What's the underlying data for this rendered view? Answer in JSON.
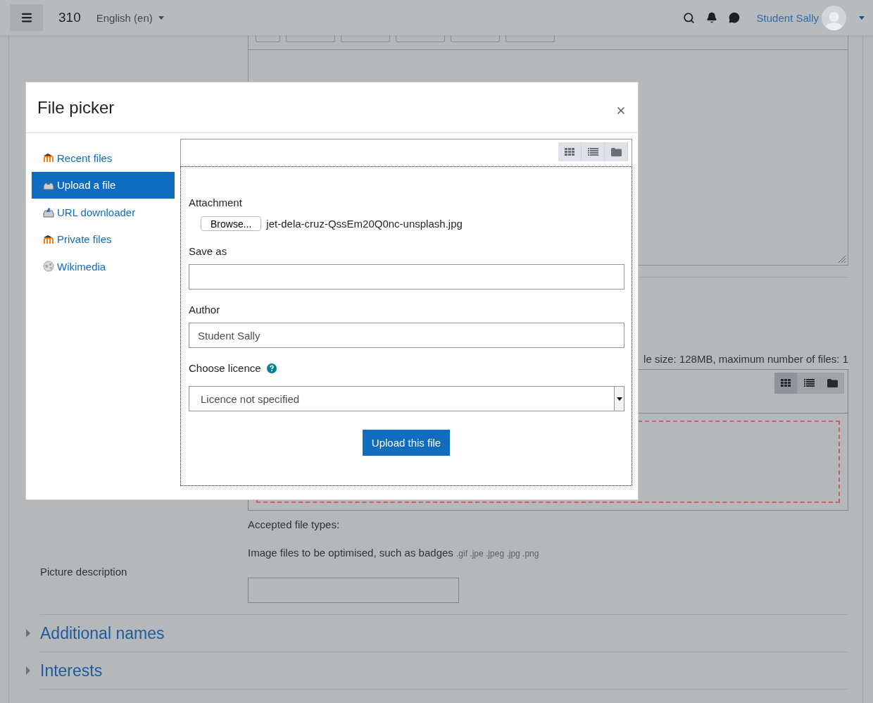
{
  "header": {
    "site_name": "310",
    "language": "English (en)",
    "user_name": "Student Sally"
  },
  "filemanager": {
    "limits_text": "le size: 128MB, maximum number of files: 1",
    "views": [
      {
        "kind": "icons",
        "selected": true
      },
      {
        "kind": "list",
        "selected": false
      },
      {
        "kind": "tree",
        "selected": false
      }
    ]
  },
  "accepted": {
    "label": "Accepted file types:",
    "description": "Image files to be optimised, such as badges",
    "extensions": ".gif .jpe .jpeg .jpg .png"
  },
  "picture_description": {
    "label": "Picture description"
  },
  "sections": [
    {
      "title": "Additional names",
      "expanded": false
    },
    {
      "title": "Interests",
      "expanded": false
    }
  ],
  "modal": {
    "title": "File picker",
    "repositories": [
      {
        "label": "Recent files",
        "kind": "moodle",
        "selected": false
      },
      {
        "label": "Upload a file",
        "kind": "upload",
        "selected": true
      },
      {
        "label": "URL downloader",
        "kind": "upload",
        "selected": false
      },
      {
        "label": "Private files",
        "kind": "moodle",
        "selected": false
      },
      {
        "label": "Wikimedia",
        "kind": "globe",
        "selected": false
      }
    ],
    "views": [
      {
        "kind": "icons",
        "selected": false
      },
      {
        "kind": "list",
        "selected": false
      },
      {
        "kind": "tree",
        "selected": false
      }
    ],
    "form": {
      "attachment_label": "Attachment",
      "browse_button": "Browse...",
      "file_name": "jet-dela-cruz-QssEm20Q0nc-unsplash.jpg",
      "save_as_label": "Save as",
      "author_label": "Author",
      "author_value": "Student Sally",
      "licence_label": "Choose licence",
      "licence_value": "Licence not specified",
      "submit_button": "Upload this file"
    }
  }
}
